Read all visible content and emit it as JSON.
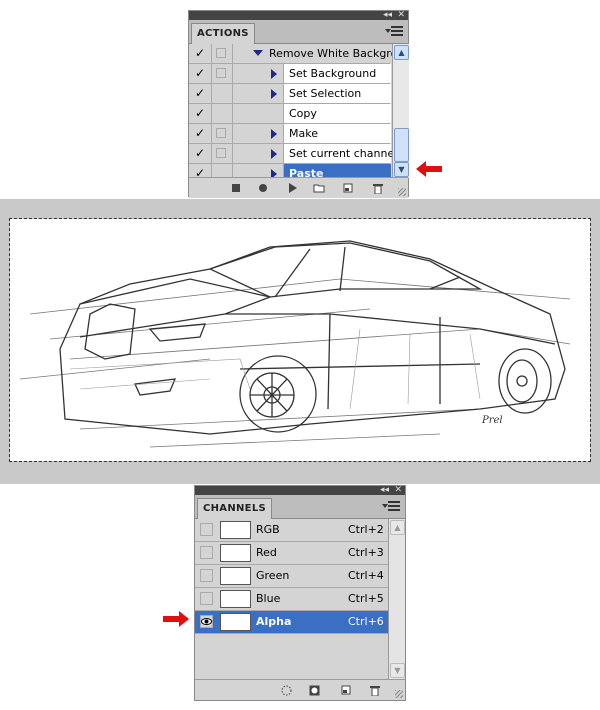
{
  "actions_panel": {
    "tab_label": "ACTIONS",
    "items": [
      {
        "checked": true,
        "dialog_box": true,
        "expanded": true,
        "label": "Remove White Backgro...",
        "selected": false
      },
      {
        "checked": true,
        "dialog_box": true,
        "expanded": false,
        "label": "Set Background",
        "selected": false
      },
      {
        "checked": true,
        "dialog_box": false,
        "expanded": false,
        "label": "Set Selection",
        "selected": false
      },
      {
        "checked": true,
        "dialog_box": false,
        "expanded": null,
        "label": "Copy",
        "selected": false
      },
      {
        "checked": true,
        "dialog_box": true,
        "expanded": false,
        "label": "Make",
        "selected": false
      },
      {
        "checked": true,
        "dialog_box": true,
        "expanded": false,
        "label": "Set current channel",
        "selected": false
      },
      {
        "checked": true,
        "dialog_box": false,
        "expanded": false,
        "label": "Paste",
        "selected": true
      }
    ],
    "footer_icons": [
      "stop-icon",
      "record-icon",
      "play-icon",
      "folder-icon",
      "new-action-icon",
      "trash-icon"
    ]
  },
  "canvas": {
    "signature": "Prel"
  },
  "channels_panel": {
    "tab_label": "CHANNELS",
    "channels": [
      {
        "name": "RGB",
        "shortcut": "Ctrl+2",
        "visible": false,
        "selected": false
      },
      {
        "name": "Red",
        "shortcut": "Ctrl+3",
        "visible": false,
        "selected": false
      },
      {
        "name": "Green",
        "shortcut": "Ctrl+4",
        "visible": false,
        "selected": false
      },
      {
        "name": "Blue",
        "shortcut": "Ctrl+5",
        "visible": false,
        "selected": false
      },
      {
        "name": "Alpha",
        "shortcut": "Ctrl+6",
        "visible": true,
        "selected": true
      }
    ],
    "footer_icons": [
      "load-selection-icon",
      "save-selection-icon",
      "new-channel-icon",
      "trash-icon"
    ]
  },
  "colors": {
    "selection": "#3a6fc4",
    "arrow": "#e01010",
    "panel": "#d4d4d4"
  }
}
